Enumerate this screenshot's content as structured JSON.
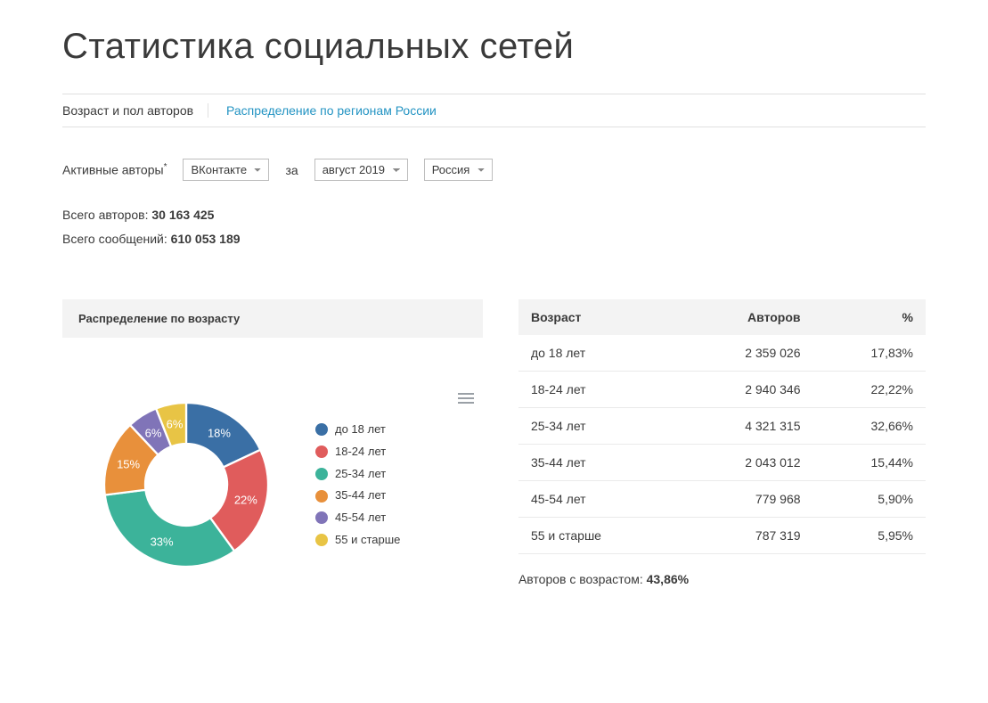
{
  "page_title": "Статистика социальных сетей",
  "tabs": {
    "active": "Возраст и пол авторов",
    "link": "Распределение по регионам России"
  },
  "filters": {
    "label_authors": "Активные авторы",
    "select_network": "ВКонтакте",
    "label_for": "за",
    "select_month": "август 2019",
    "select_region": "Россия"
  },
  "totals": {
    "authors_label": "Всего авторов: ",
    "authors_value": "30 163 425",
    "messages_label": "Всего сообщений: ",
    "messages_value": "610 053 189"
  },
  "chart_panel_title": "Распределение по возрасту",
  "table": {
    "headers": {
      "age": "Возраст",
      "authors": "Авторов",
      "pct": "%"
    },
    "rows": [
      {
        "age": "до 18 лет",
        "authors": "2 359 026",
        "pct": "17,83%"
      },
      {
        "age": "18-24 лет",
        "authors": "2 940 346",
        "pct": "22,22%"
      },
      {
        "age": "25-34 лет",
        "authors": "4 321 315",
        "pct": "32,66%"
      },
      {
        "age": "35-44 лет",
        "authors": "2 043 012",
        "pct": "15,44%"
      },
      {
        "age": "45-54 лет",
        "authors": "779 968",
        "pct": "5,90%"
      },
      {
        "age": "55 и старше",
        "authors": "787 319",
        "pct": "5,95%"
      }
    ]
  },
  "footnote": {
    "label": "Авторов с возрастом: ",
    "value": "43,86%"
  },
  "chart_data": {
    "type": "pie",
    "title": "Распределение по возрасту",
    "categories": [
      "до 18 лет",
      "18-24 лет",
      "25-34 лет",
      "35-44 лет",
      "45-54 лет",
      "55 и старше"
    ],
    "values": [
      18,
      22,
      33,
      15,
      6,
      6
    ],
    "label_values": [
      "18%",
      "22%",
      "33%",
      "15%",
      "6%",
      "6%"
    ],
    "colors": [
      "#3a6fa5",
      "#e05c5c",
      "#3cb39a",
      "#e8903b",
      "#8074b8",
      "#e8c445"
    ],
    "donut_inner_ratio": 0.5
  }
}
